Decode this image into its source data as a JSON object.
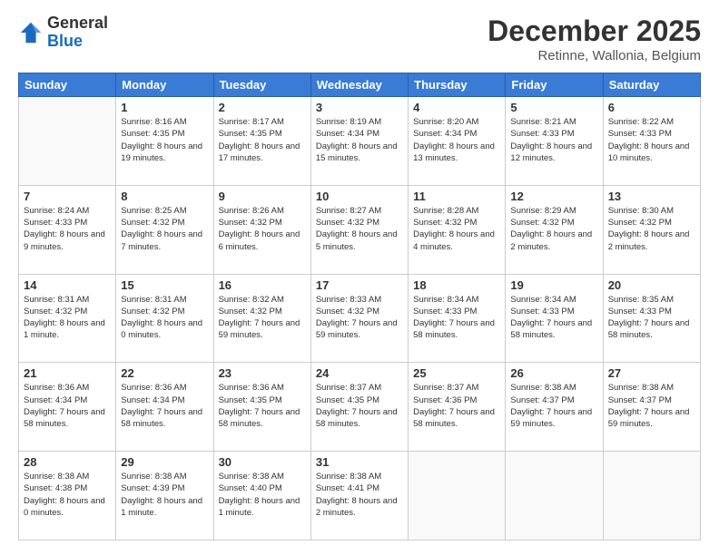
{
  "logo": {
    "general": "General",
    "blue": "Blue"
  },
  "header": {
    "month": "December 2025",
    "location": "Retinne, Wallonia, Belgium"
  },
  "weekdays": [
    "Sunday",
    "Monday",
    "Tuesday",
    "Wednesday",
    "Thursday",
    "Friday",
    "Saturday"
  ],
  "weeks": [
    [
      {
        "day": "",
        "info": ""
      },
      {
        "day": "1",
        "info": "Sunrise: 8:16 AM\nSunset: 4:35 PM\nDaylight: 8 hours\nand 19 minutes."
      },
      {
        "day": "2",
        "info": "Sunrise: 8:17 AM\nSunset: 4:35 PM\nDaylight: 8 hours\nand 17 minutes."
      },
      {
        "day": "3",
        "info": "Sunrise: 8:19 AM\nSunset: 4:34 PM\nDaylight: 8 hours\nand 15 minutes."
      },
      {
        "day": "4",
        "info": "Sunrise: 8:20 AM\nSunset: 4:34 PM\nDaylight: 8 hours\nand 13 minutes."
      },
      {
        "day": "5",
        "info": "Sunrise: 8:21 AM\nSunset: 4:33 PM\nDaylight: 8 hours\nand 12 minutes."
      },
      {
        "day": "6",
        "info": "Sunrise: 8:22 AM\nSunset: 4:33 PM\nDaylight: 8 hours\nand 10 minutes."
      }
    ],
    [
      {
        "day": "7",
        "info": "Sunrise: 8:24 AM\nSunset: 4:33 PM\nDaylight: 8 hours\nand 9 minutes."
      },
      {
        "day": "8",
        "info": "Sunrise: 8:25 AM\nSunset: 4:32 PM\nDaylight: 8 hours\nand 7 minutes."
      },
      {
        "day": "9",
        "info": "Sunrise: 8:26 AM\nSunset: 4:32 PM\nDaylight: 8 hours\nand 6 minutes."
      },
      {
        "day": "10",
        "info": "Sunrise: 8:27 AM\nSunset: 4:32 PM\nDaylight: 8 hours\nand 5 minutes."
      },
      {
        "day": "11",
        "info": "Sunrise: 8:28 AM\nSunset: 4:32 PM\nDaylight: 8 hours\nand 4 minutes."
      },
      {
        "day": "12",
        "info": "Sunrise: 8:29 AM\nSunset: 4:32 PM\nDaylight: 8 hours\nand 2 minutes."
      },
      {
        "day": "13",
        "info": "Sunrise: 8:30 AM\nSunset: 4:32 PM\nDaylight: 8 hours\nand 2 minutes."
      }
    ],
    [
      {
        "day": "14",
        "info": "Sunrise: 8:31 AM\nSunset: 4:32 PM\nDaylight: 8 hours\nand 1 minute."
      },
      {
        "day": "15",
        "info": "Sunrise: 8:31 AM\nSunset: 4:32 PM\nDaylight: 8 hours\nand 0 minutes."
      },
      {
        "day": "16",
        "info": "Sunrise: 8:32 AM\nSunset: 4:32 PM\nDaylight: 7 hours\nand 59 minutes."
      },
      {
        "day": "17",
        "info": "Sunrise: 8:33 AM\nSunset: 4:32 PM\nDaylight: 7 hours\nand 59 minutes."
      },
      {
        "day": "18",
        "info": "Sunrise: 8:34 AM\nSunset: 4:33 PM\nDaylight: 7 hours\nand 58 minutes."
      },
      {
        "day": "19",
        "info": "Sunrise: 8:34 AM\nSunset: 4:33 PM\nDaylight: 7 hours\nand 58 minutes."
      },
      {
        "day": "20",
        "info": "Sunrise: 8:35 AM\nSunset: 4:33 PM\nDaylight: 7 hours\nand 58 minutes."
      }
    ],
    [
      {
        "day": "21",
        "info": "Sunrise: 8:36 AM\nSunset: 4:34 PM\nDaylight: 7 hours\nand 58 minutes."
      },
      {
        "day": "22",
        "info": "Sunrise: 8:36 AM\nSunset: 4:34 PM\nDaylight: 7 hours\nand 58 minutes."
      },
      {
        "day": "23",
        "info": "Sunrise: 8:36 AM\nSunset: 4:35 PM\nDaylight: 7 hours\nand 58 minutes."
      },
      {
        "day": "24",
        "info": "Sunrise: 8:37 AM\nSunset: 4:35 PM\nDaylight: 7 hours\nand 58 minutes."
      },
      {
        "day": "25",
        "info": "Sunrise: 8:37 AM\nSunset: 4:36 PM\nDaylight: 7 hours\nand 58 minutes."
      },
      {
        "day": "26",
        "info": "Sunrise: 8:38 AM\nSunset: 4:37 PM\nDaylight: 7 hours\nand 59 minutes."
      },
      {
        "day": "27",
        "info": "Sunrise: 8:38 AM\nSunset: 4:37 PM\nDaylight: 7 hours\nand 59 minutes."
      }
    ],
    [
      {
        "day": "28",
        "info": "Sunrise: 8:38 AM\nSunset: 4:38 PM\nDaylight: 8 hours\nand 0 minutes."
      },
      {
        "day": "29",
        "info": "Sunrise: 8:38 AM\nSunset: 4:39 PM\nDaylight: 8 hours\nand 1 minute."
      },
      {
        "day": "30",
        "info": "Sunrise: 8:38 AM\nSunset: 4:40 PM\nDaylight: 8 hours\nand 1 minute."
      },
      {
        "day": "31",
        "info": "Sunrise: 8:38 AM\nSunset: 4:41 PM\nDaylight: 8 hours\nand 2 minutes."
      },
      {
        "day": "",
        "info": ""
      },
      {
        "day": "",
        "info": ""
      },
      {
        "day": "",
        "info": ""
      }
    ]
  ]
}
